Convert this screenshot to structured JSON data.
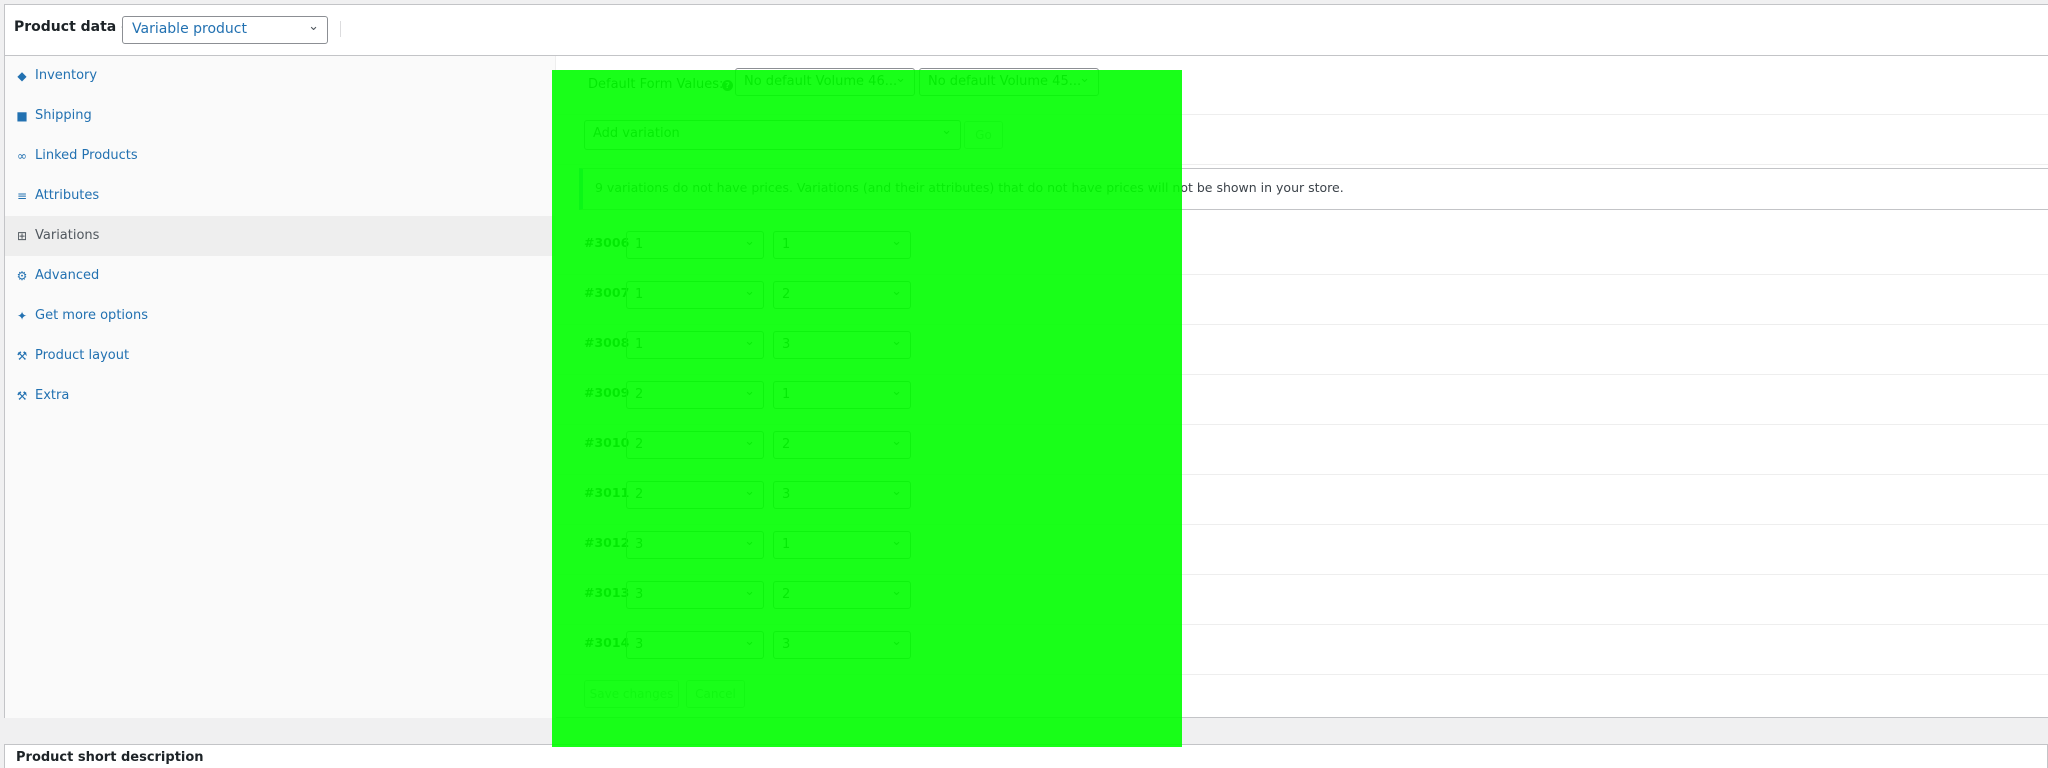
{
  "header": {
    "title": "Product data —",
    "product_type": "Variable product"
  },
  "tabs": [
    {
      "label": "Inventory",
      "icon": "tag-icon"
    },
    {
      "label": "Shipping",
      "icon": "truck-icon"
    },
    {
      "label": "Linked Products",
      "icon": "link-icon"
    },
    {
      "label": "Attributes",
      "icon": "list-icon"
    },
    {
      "label": "Variations",
      "icon": "grid-icon",
      "active": true
    },
    {
      "label": "Advanced",
      "icon": "gear-icon"
    },
    {
      "label": "Get more options",
      "icon": "plugin-icon"
    },
    {
      "label": "Product layout",
      "icon": "wrench-icon"
    },
    {
      "label": "Extra",
      "icon": "wrench-icon"
    }
  ],
  "variations_panel": {
    "defaults_label": "Default Form Values:",
    "default_select_1": "No default Volume 46...",
    "default_select_2": "No default Volume 45...",
    "add_variation_label": "Add variation",
    "go_button": "Go",
    "notice": "9 variations do not have prices. Variations (and their attributes) that do not have prices will not be shown in your store.",
    "variations": [
      {
        "id": "#3006",
        "attr1": "1",
        "attr2": "1"
      },
      {
        "id": "#3007",
        "attr1": "1",
        "attr2": "2"
      },
      {
        "id": "#3008",
        "attr1": "1",
        "attr2": "3"
      },
      {
        "id": "#3009",
        "attr1": "2",
        "attr2": "1"
      },
      {
        "id": "#3010",
        "attr1": "2",
        "attr2": "2"
      },
      {
        "id": "#3011",
        "attr1": "2",
        "attr2": "3"
      },
      {
        "id": "#3012",
        "attr1": "3",
        "attr2": "1"
      },
      {
        "id": "#3013",
        "attr1": "3",
        "attr2": "2"
      },
      {
        "id": "#3014",
        "attr1": "3",
        "attr2": "3"
      }
    ],
    "save_button": "Save changes",
    "cancel_button": "Cancel"
  },
  "short_description_label": "Product short description",
  "colors": {
    "accent": "#2271b1",
    "overlay": "#00ff00",
    "notice_border": "#72aee6"
  }
}
